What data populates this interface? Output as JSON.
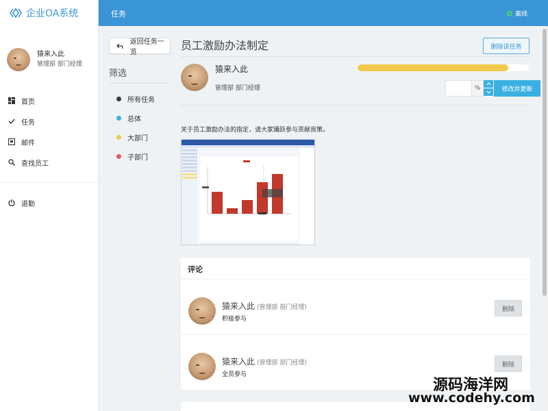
{
  "app": {
    "brand": "企业OA系统"
  },
  "user": {
    "name": "猿来入此",
    "role": "管理部 部门经理"
  },
  "nav": [
    {
      "label": "首页",
      "icon": "dashboard-icon"
    },
    {
      "label": "任务",
      "icon": "check-icon"
    },
    {
      "label": "邮件",
      "icon": "inbox-icon"
    },
    {
      "label": "查找员工",
      "icon": "search-icon"
    },
    {
      "label": "退勤",
      "icon": "power-icon"
    }
  ],
  "topbar": {
    "title": "任务",
    "status": "离线",
    "status_color": "#4cd964"
  },
  "filter": {
    "back_label": "返回任务一览",
    "title": "筛选",
    "items": [
      {
        "label": "所有任务",
        "color": "#2f3a44"
      },
      {
        "label": "总体",
        "color": "#3ab0e2"
      },
      {
        "label": "大部门",
        "color": "#f2c94c"
      },
      {
        "label": "子部门",
        "color": "#f0545c"
      }
    ]
  },
  "task": {
    "title": "员工激励办法制定",
    "delete_label": "删除该任务",
    "owner_name": "猿来入此",
    "owner_role": "管理部 部门经理",
    "progress_percent": 88,
    "percent_value": "",
    "percent_suffix": "%",
    "update_label": "修改并更新",
    "description": "关于员工激励办法的指定，请大家踊跃参与贡献良策。"
  },
  "comments": {
    "title": "评论",
    "items": [
      {
        "name": "猿来入此",
        "role": "(管理部 部门经理)",
        "text": "积极参与",
        "delete_label": "删除"
      },
      {
        "name": "猿来入此",
        "role": "(管理部 部门经理)",
        "text": "全员参与",
        "delete_label": "删除"
      }
    ]
  },
  "watermark": {
    "line1": "源码海洋网",
    "line2": "www.codehy.com"
  },
  "colors": {
    "primary": "#3a95d6",
    "accent": "#3ab0e2",
    "progress": "#f2c94c"
  }
}
